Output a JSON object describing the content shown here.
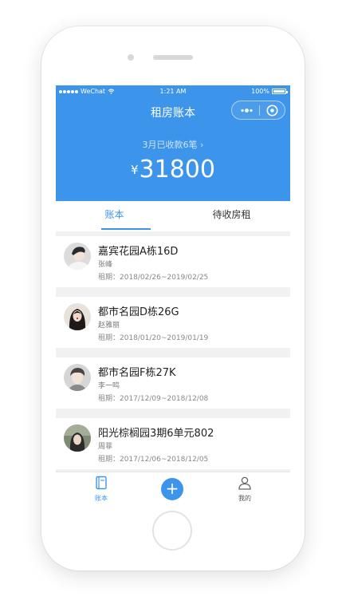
{
  "status_bar": {
    "carrier": "WeChat",
    "time": "1:21 AM",
    "battery": "100%"
  },
  "nav": {
    "title": "租房账本"
  },
  "summary": {
    "link_label": "3月已收款6笔 ›",
    "currency": "¥",
    "amount": "31800"
  },
  "tabs": [
    {
      "label": "账本",
      "active": true
    },
    {
      "label": "待收房租",
      "active": false
    }
  ],
  "records": [
    {
      "title": "嘉宾花园A栋16D",
      "tenant": "张峰",
      "period": "租期：2018/02/26~2019/02/25"
    },
    {
      "title": "都市名园D栋26G",
      "tenant": "赵雅丽",
      "period": "租期：2018/01/20~2019/01/19"
    },
    {
      "title": "都市名园F栋27K",
      "tenant": "李一鸣",
      "period": "租期：2017/12/09~2018/12/08"
    },
    {
      "title": "阳光棕榈园3期6单元802",
      "tenant": "周菲",
      "period": "租期：2017/12/06~2018/12/05"
    }
  ],
  "tabbar": {
    "ledger": "账本",
    "add": "+",
    "mine": "我的"
  },
  "colors": {
    "accent": "#3d94eb",
    "background": "#f1f1f1"
  }
}
